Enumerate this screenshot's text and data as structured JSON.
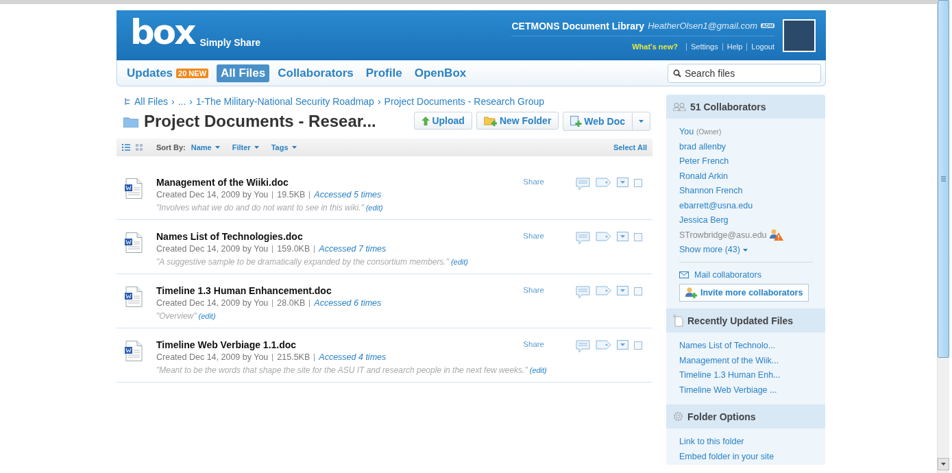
{
  "header": {
    "logo": "box",
    "tagline": "Simply Share",
    "library": "CETMONS Document Library",
    "email": "HeatherOlsen1@gmail.com",
    "role_badge": "ADM",
    "links": [
      {
        "label": "What's new?",
        "kind": "highlight"
      },
      {
        "label": "Settings",
        "kind": "plain"
      },
      {
        "label": "Help",
        "kind": "plain"
      },
      {
        "label": "Logout",
        "kind": "plain"
      }
    ]
  },
  "nav": {
    "tabs": [
      {
        "label": "Updates",
        "badge": "20 NEW",
        "selected": false
      },
      {
        "label": "All Files",
        "selected": true
      },
      {
        "label": "Collaborators",
        "selected": false
      },
      {
        "label": "Profile",
        "selected": false
      },
      {
        "label": "OpenBox",
        "selected": false
      }
    ],
    "search": {
      "placeholder": "Search files"
    }
  },
  "breadcrumb": {
    "separator": "›",
    "items": [
      "All Files",
      "...",
      "1-The Military-National Security Roadmap",
      "Project Documents - Research Group"
    ]
  },
  "folder_title": "Project Documents - Resear...",
  "buttons": [
    {
      "label": "Upload",
      "kind": "upload"
    },
    {
      "label": "New Folder",
      "kind": "folder"
    },
    {
      "label": "Web Doc",
      "kind": "webdoc"
    }
  ],
  "toolbar": {
    "views": [
      {
        "kind": "list",
        "selected": true
      },
      {
        "kind": "grid",
        "selected": false
      }
    ],
    "sort_label": "Sort By:",
    "menus": [
      "Name",
      "Filter",
      "Tags"
    ],
    "select_all": "Select All"
  },
  "files": [
    {
      "name": "Management of the Wiiki.doc",
      "created": "Created Dec 14, 2009 by You",
      "size": "19.5KB",
      "accessed": "Accessed 5 times",
      "description": "\"Involves what we do and do not want to see in this wiki.\"",
      "edit": "(edit)",
      "share": "Share",
      "checked": false
    },
    {
      "name": "Names List of Technologies.doc",
      "created": "Created Dec 14, 2009 by You",
      "size": "159.0KB",
      "accessed": "Accessed 7 times",
      "description": "\"A suggestive sample to be dramatically expanded by the consortium members.\"",
      "edit": "(edit)",
      "share": "Share",
      "checked": false
    },
    {
      "name": "Timeline 1.3 Human Enhancement.doc",
      "created": "Created Dec 14, 2009 by You",
      "size": "28.0KB",
      "accessed": "Accessed 6 times",
      "description": "\"Overview\"",
      "edit": "(edit)",
      "share": "Share",
      "checked": false
    },
    {
      "name": "Timeline Web Verbiage 1.1.doc",
      "created": "Created Dec 14, 2009 by You",
      "size": "215.5KB",
      "accessed": "Accessed 4 times",
      "description": "\"Meant to be the words that shape the site for the ASU IT and research people in the next few weeks.\"",
      "edit": "(edit)",
      "share": "Share",
      "checked": false
    }
  ],
  "sidebar": {
    "collaborators": {
      "title": "51 Collaborators",
      "members": [
        {
          "name": "You",
          "note": "(Owner)",
          "pending": false
        },
        {
          "name": "brad allenby",
          "pending": false
        },
        {
          "name": "Peter French",
          "pending": false
        },
        {
          "name": "Ronald Arkin",
          "pending": false
        },
        {
          "name": "Shannon French",
          "pending": false
        },
        {
          "name": "ebarrett@usna.edu",
          "pending": false
        },
        {
          "name": "Jessica Berg",
          "pending": false
        },
        {
          "name": "STrowbridge@asu.edu",
          "pending": true
        }
      ],
      "show_more": "Show more (43)",
      "mail": "Mail collaborators",
      "invite": "Invite more collaborators"
    },
    "recent": {
      "title": "Recently Updated Files",
      "files": [
        "Names List of Technolo...",
        "Management of the Wiik...",
        "Timeline 1.3 Human Enh...",
        "Timeline Web Verbiage ..."
      ]
    },
    "folder_options": {
      "title": "Folder Options",
      "links": [
        "Link to this folder",
        "Embed folder in your site"
      ]
    }
  }
}
